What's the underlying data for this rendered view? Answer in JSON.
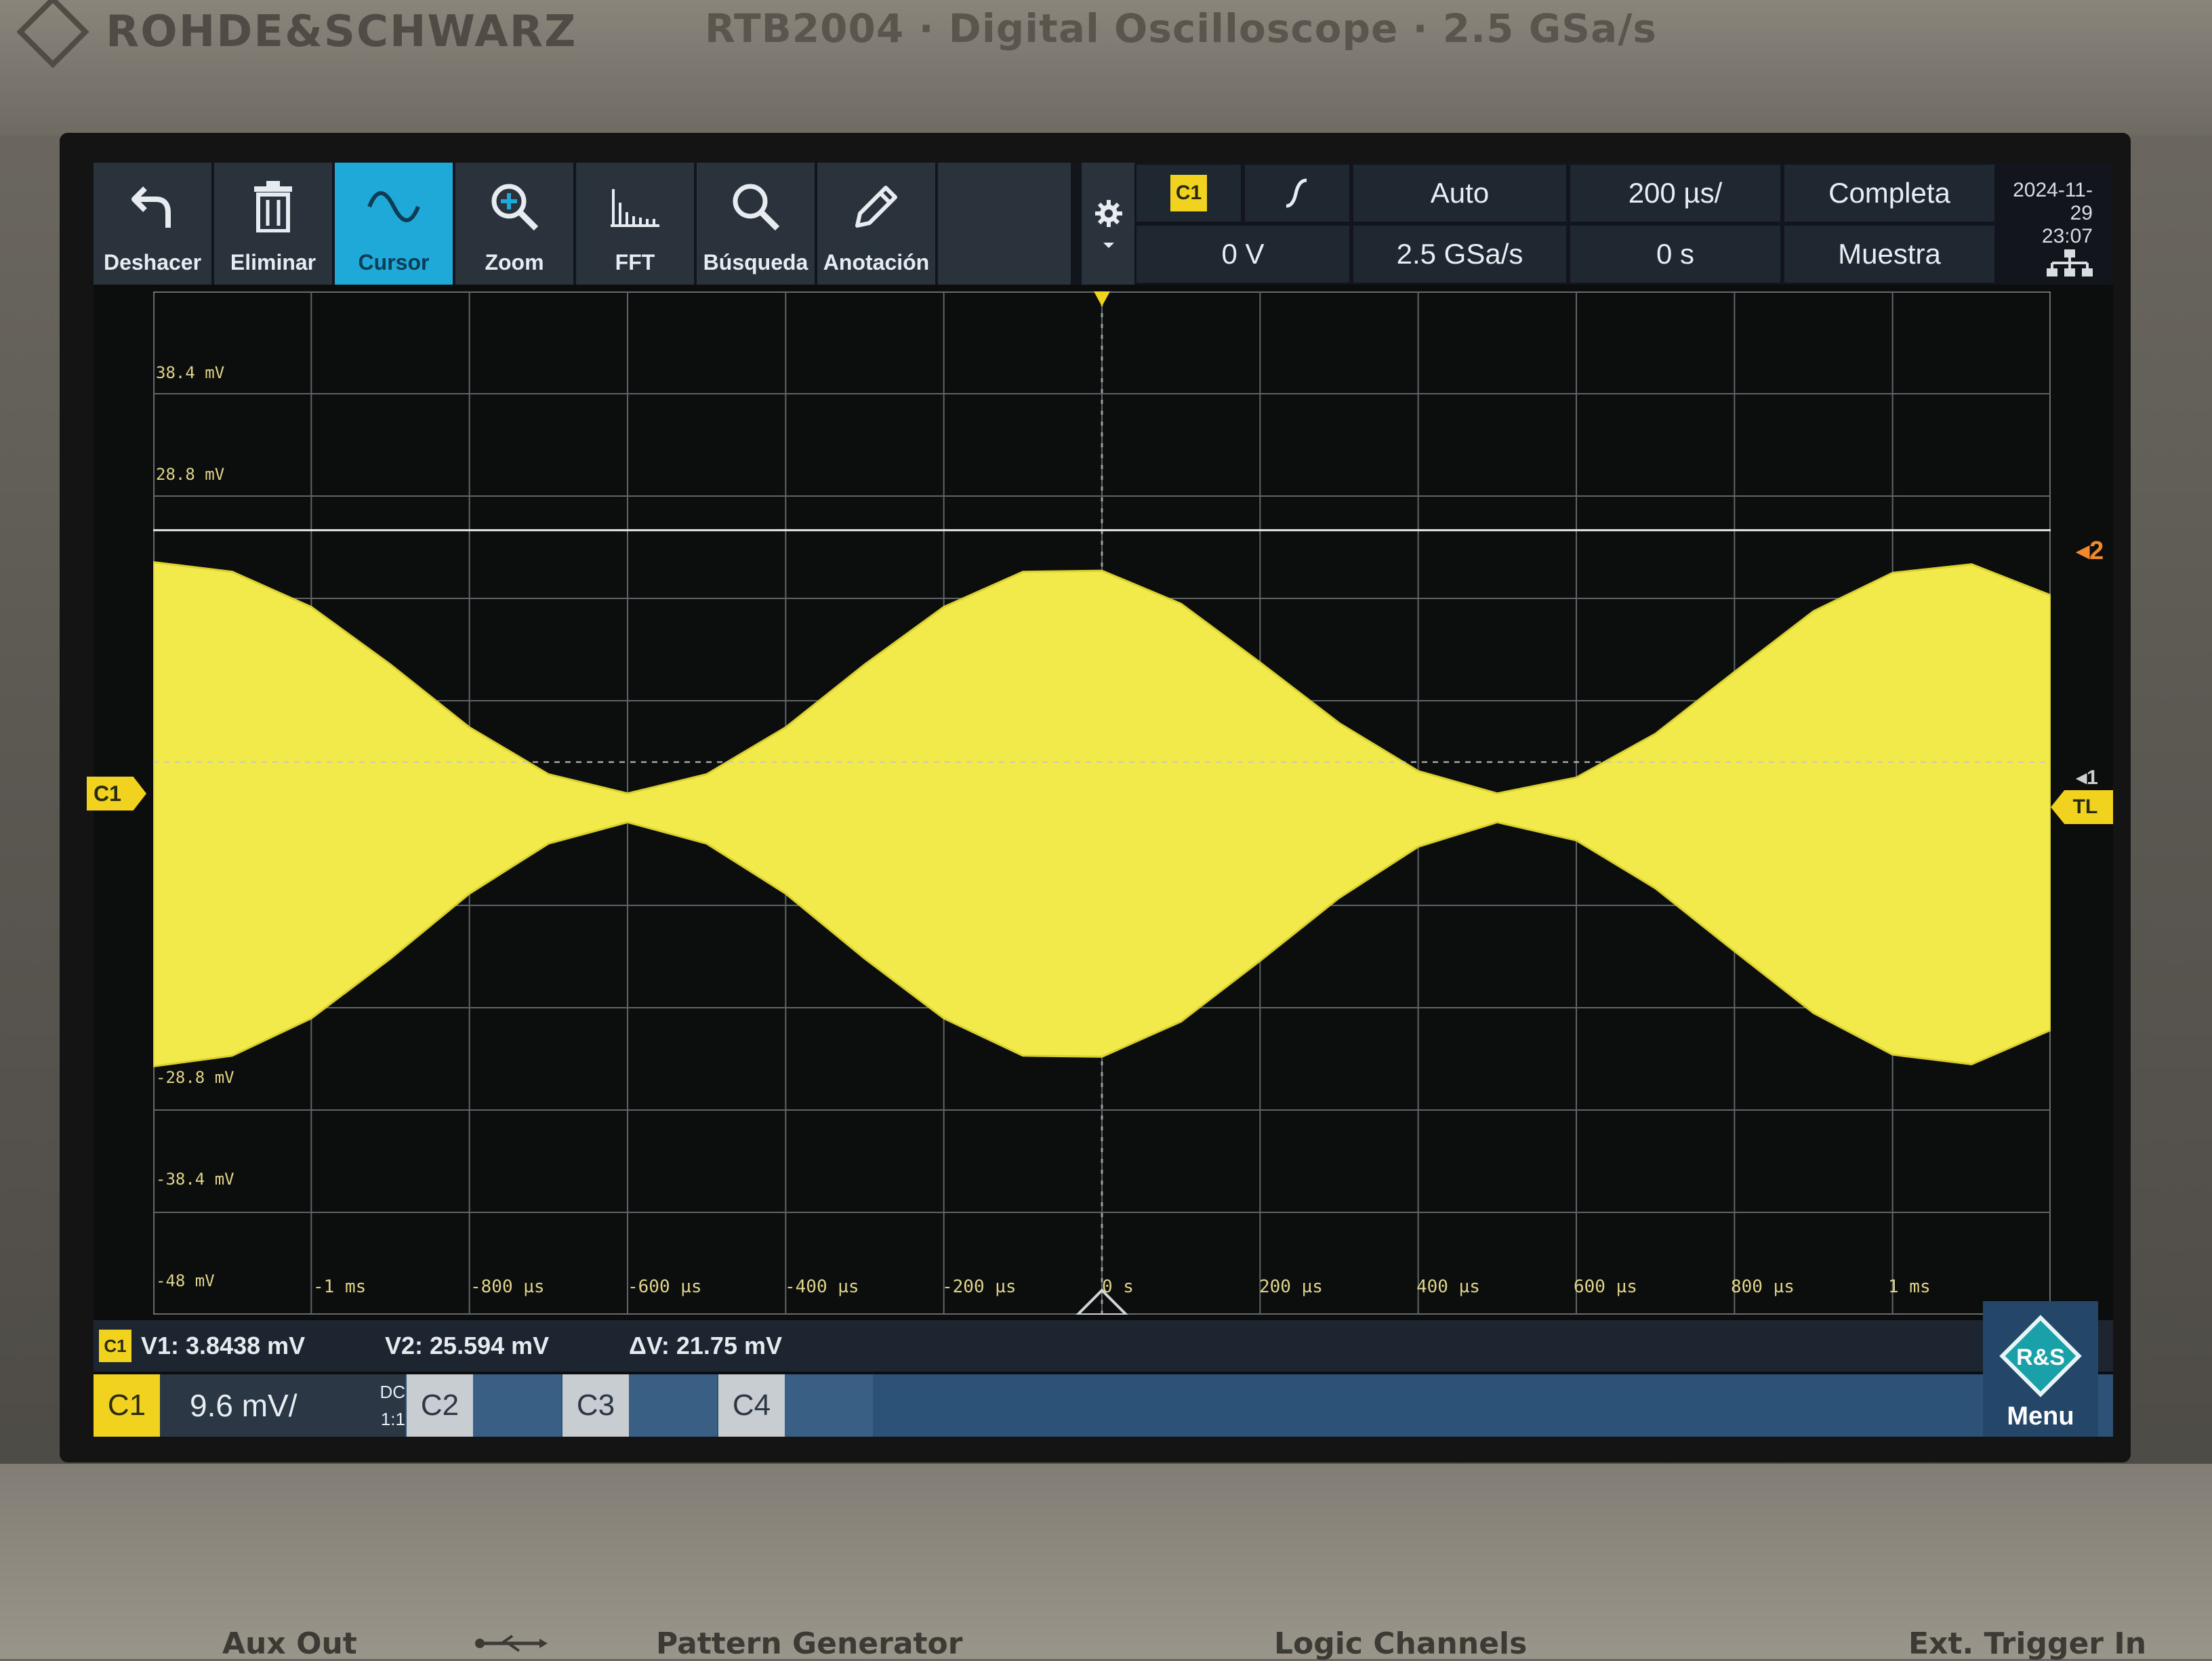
{
  "instrument": {
    "brand": "ROHDE&SCHWARZ",
    "model": "RTB2004 · Digital Oscilloscope · 2.5 GSa/s"
  },
  "toolbar": {
    "tools": [
      {
        "label": "Deshacer",
        "icon": "undo-icon"
      },
      {
        "label": "Eliminar",
        "icon": "trash-icon"
      },
      {
        "label": "Cursor",
        "icon": "cursor-wave-icon",
        "active": true
      },
      {
        "label": "Zoom",
        "icon": "zoom-icon"
      },
      {
        "label": "FFT",
        "icon": "fft-icon"
      },
      {
        "label": "Búsqueda",
        "icon": "search-icon"
      },
      {
        "label": "Anotación",
        "icon": "pencil-icon"
      }
    ]
  },
  "trigger": {
    "source": "C1",
    "slope_icon": "rising-edge-icon",
    "level": "0 V",
    "mode": "Auto",
    "sample_rate": "2.5 GSa/s",
    "timebase": "200 µs/",
    "position": "0 s",
    "acq_mode": "Completa",
    "acq_type": "Muestra"
  },
  "datetime": {
    "date": "2024-11-29",
    "time": "23:07"
  },
  "plot": {
    "y_labels": [
      "38.4 mV",
      "28.8 mV",
      "-28.8 mV",
      "-38.4 mV",
      "-48 mV"
    ],
    "x_labels": [
      "-1 ms",
      "-800 µs",
      "-600 µs",
      "-400 µs",
      "-200 µs",
      "0 s",
      "200 µs",
      "400 µs",
      "600 µs",
      "800 µs",
      "1 ms"
    ],
    "channel_marker": "C1",
    "trigger_level_marker": "TL",
    "cursor_2_tag": "2",
    "cursor_1_tag": "1",
    "trace_color": "#f2ea4a"
  },
  "chart_data": {
    "type": "line",
    "xlabel": "",
    "ylabel": "",
    "x_unit": "µs",
    "y_unit": "mV",
    "xlim": [
      -1200,
      1200
    ],
    "ylim": [
      -48,
      48
    ],
    "series": [
      {
        "x": [
          -1200,
          -1100,
          -1000,
          -900,
          -800,
          -700,
          -600,
          -500,
          -400,
          -300,
          -200,
          -100,
          0,
          100,
          200,
          300,
          400,
          500,
          600,
          700,
          800,
          900,
          1000,
          1100,
          1200
        ],
        "y_upper": [
          22.6,
          21.7,
          18.4,
          13.0,
          7.1,
          2.7,
          0.9,
          2.7,
          7.1,
          13.0,
          18.4,
          21.7,
          21.8,
          18.7,
          13.2,
          7.5,
          3.0,
          0.9,
          2.4,
          6.5,
          12.3,
          18.0,
          21.6,
          22.4,
          19.5
        ],
        "y_lower": [
          -24.7,
          -23.7,
          -20.2,
          -14.6,
          -8.5,
          -3.8,
          -1.8,
          -3.8,
          -8.5,
          -14.6,
          -20.2,
          -23.7,
          -23.8,
          -20.5,
          -14.8,
          -8.9,
          -4.1,
          -1.8,
          -3.5,
          -8.0,
          -13.9,
          -19.7,
          -23.6,
          -24.5,
          -21.3
        ]
      }
    ]
  },
  "cursor_readout": {
    "source": "C1",
    "v1": "V1: 3.8438 mV",
    "v2": "V2: 25.594 mV",
    "dv": "ΔV: 21.75 mV"
  },
  "channels": [
    {
      "name": "C1",
      "scale": "9.6 mV/",
      "coupling": "DC",
      "probe": "1:1",
      "active": true
    },
    {
      "name": "C2"
    },
    {
      "name": "C3"
    },
    {
      "name": "C4"
    }
  ],
  "menu": {
    "label": "Menu",
    "logo_text": "R&S"
  },
  "ports": [
    "Aux Out",
    "Pattern Generator",
    "Logic Channels",
    "Ext. Trigger In"
  ]
}
